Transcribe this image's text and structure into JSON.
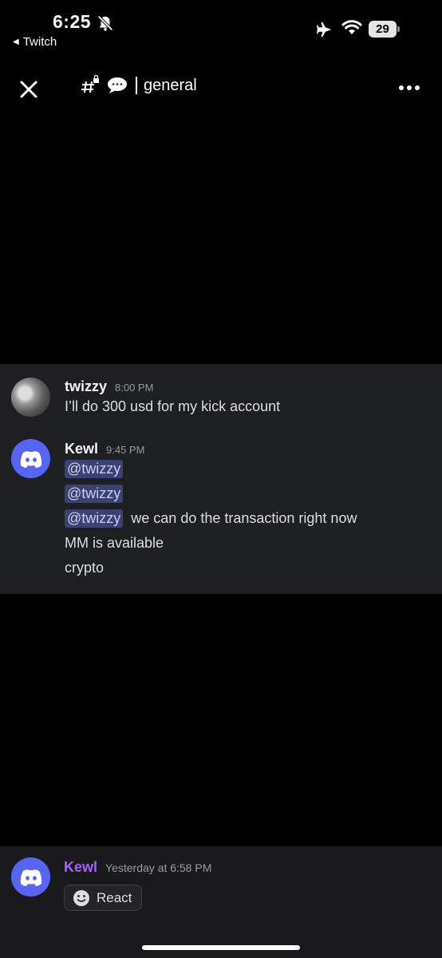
{
  "status_bar": {
    "time": "6:25",
    "back_app": "Twitch",
    "battery": "29"
  },
  "header": {
    "channel_name": "general"
  },
  "messages": [
    {
      "username": "twizzy",
      "timestamp": "8:00 PM",
      "lines": [
        "I’ll do 300 usd for my kick account"
      ]
    },
    {
      "username": "Kewl",
      "timestamp": "9:45 PM",
      "mentions": [
        "@twizzy",
        "@twizzy",
        "@twizzy"
      ],
      "mention_tail": "we can do the transaction right now",
      "lines": [
        "MM is available",
        "crypto"
      ]
    }
  ],
  "bottom_sheet": {
    "username": "Kewl",
    "timestamp": "Yesterday at 6:58 PM",
    "react_label": "React"
  },
  "colors": {
    "accent": "#5865f2",
    "username_highlight": "#a560ff",
    "panel_bg": "#1e1f22"
  }
}
